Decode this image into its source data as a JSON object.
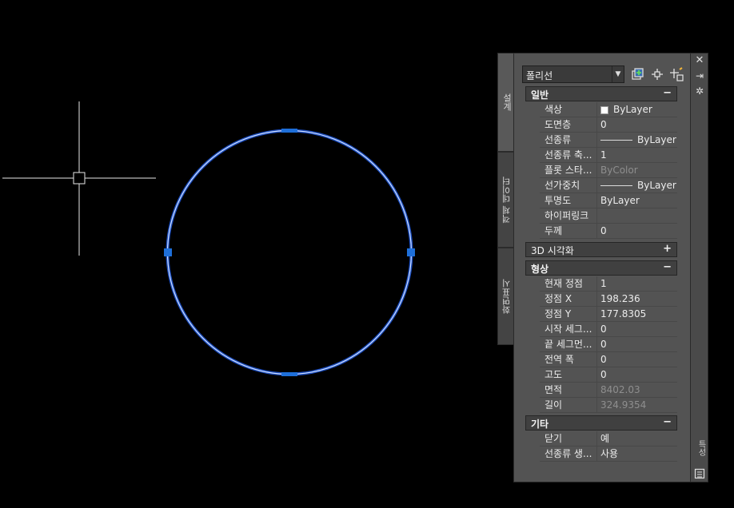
{
  "palette": {
    "tabs": [
      "설계",
      "객체 데이터",
      "화면표시"
    ],
    "object_type": "폴리선",
    "strip_label": "특성",
    "sections": [
      {
        "name": "일반",
        "toggle": "−",
        "rows": [
          {
            "k": "색상",
            "v": "ByLayer",
            "kind": "swatch"
          },
          {
            "k": "도면층",
            "v": "0"
          },
          {
            "k": "선종류",
            "v": "ByLayer",
            "kind": "line"
          },
          {
            "k": "선종류 축...",
            "v": "1"
          },
          {
            "k": "플롯 스타...",
            "v": "ByColor",
            "dim": true
          },
          {
            "k": "선가중치",
            "v": "ByLayer",
            "kind": "line"
          },
          {
            "k": "투명도",
            "v": "ByLayer"
          },
          {
            "k": "하이퍼링크",
            "v": ""
          },
          {
            "k": "두께",
            "v": "0"
          }
        ]
      },
      {
        "name": "3D 시각화",
        "toggle": "+",
        "rows": []
      },
      {
        "name": "형상",
        "toggle": "−",
        "rows": [
          {
            "k": "현재 정점",
            "v": "1"
          },
          {
            "k": "정점 X",
            "v": "198.236"
          },
          {
            "k": "정점 Y",
            "v": "177.8305"
          },
          {
            "k": "시작 세그...",
            "v": "0"
          },
          {
            "k": "끝 세그먼...",
            "v": "0"
          },
          {
            "k": "전역 폭",
            "v": "0"
          },
          {
            "k": "고도",
            "v": "0"
          },
          {
            "k": "면적",
            "v": "8402.03",
            "dim": true
          },
          {
            "k": "길이",
            "v": "324.9354",
            "dim": true
          }
        ]
      },
      {
        "name": "기타",
        "toggle": "−",
        "rows": [
          {
            "k": "닫기",
            "v": "예"
          },
          {
            "k": "선종류 생...",
            "v": "사용"
          }
        ]
      }
    ]
  },
  "colors": {
    "accent": "#1e6fd9",
    "circle": "#8fb6ff"
  }
}
